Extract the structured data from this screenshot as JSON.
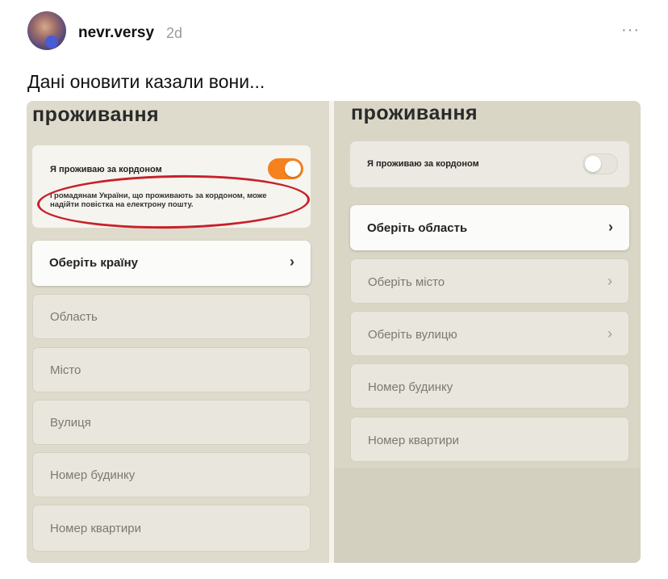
{
  "post": {
    "username": "nevr.versy",
    "time_ago": "2d",
    "more_label": "···",
    "caption": "Дані оновити казали вони..."
  },
  "left_screen": {
    "title": "проживання",
    "toggle_label": "Я проживаю за кордоном",
    "toggle_on": true,
    "notice": "Громадянам України, що проживають за кордоном, може надійти повістка на електрону пошту.",
    "fields": [
      {
        "label": "Оберіть країну",
        "chevron": "›"
      },
      {
        "label": "Область"
      },
      {
        "label": "Місто"
      },
      {
        "label": "Вулиця"
      },
      {
        "label": "Номер будинку"
      },
      {
        "label": "Номер квартири"
      }
    ]
  },
  "right_screen": {
    "title": "проживання",
    "toggle_label": "Я проживаю за кордоном",
    "toggle_on": false,
    "fields": [
      {
        "label": "Оберіть область",
        "chevron": "›"
      },
      {
        "label": "Оберіть місто",
        "chevron": "›"
      },
      {
        "label": "Оберіть вулицю",
        "chevron": "›"
      },
      {
        "label": "Номер будинку"
      },
      {
        "label": "Номер квартири"
      }
    ]
  },
  "colors": {
    "toggle_on": "#f5821f",
    "annotation": "#c8202a",
    "panel_background": "#dedbcc"
  }
}
